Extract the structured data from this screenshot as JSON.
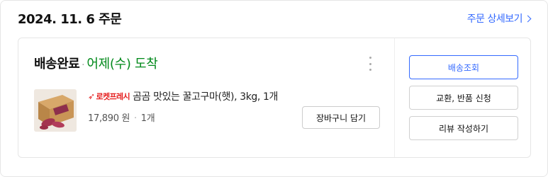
{
  "order": {
    "date": "2024. 11. 6 주문",
    "detail_link": "주문 상세보기"
  },
  "shipment": {
    "status": "배송완료",
    "separator": "·",
    "eta": "어제(수) 도착",
    "more_icon": "more-vertical-icon"
  },
  "product": {
    "badge": "로켓프레시",
    "badge_icon": "rocket-icon",
    "name": "곰곰 맛있는 꿀고구마(햇), 3kg, 1개",
    "price": "17,890 원",
    "qty": "1개",
    "thumb": "sweet-potato-box-image"
  },
  "buttons": {
    "add_to_cart": "장바구니 담기",
    "track": "배송조회",
    "exchange_return": "교환, 반품 신청",
    "review": "리뷰 작성하기"
  },
  "colors": {
    "accent": "#346aff",
    "delivered_green": "#00891a",
    "rocket_red": "#e51f1f"
  }
}
